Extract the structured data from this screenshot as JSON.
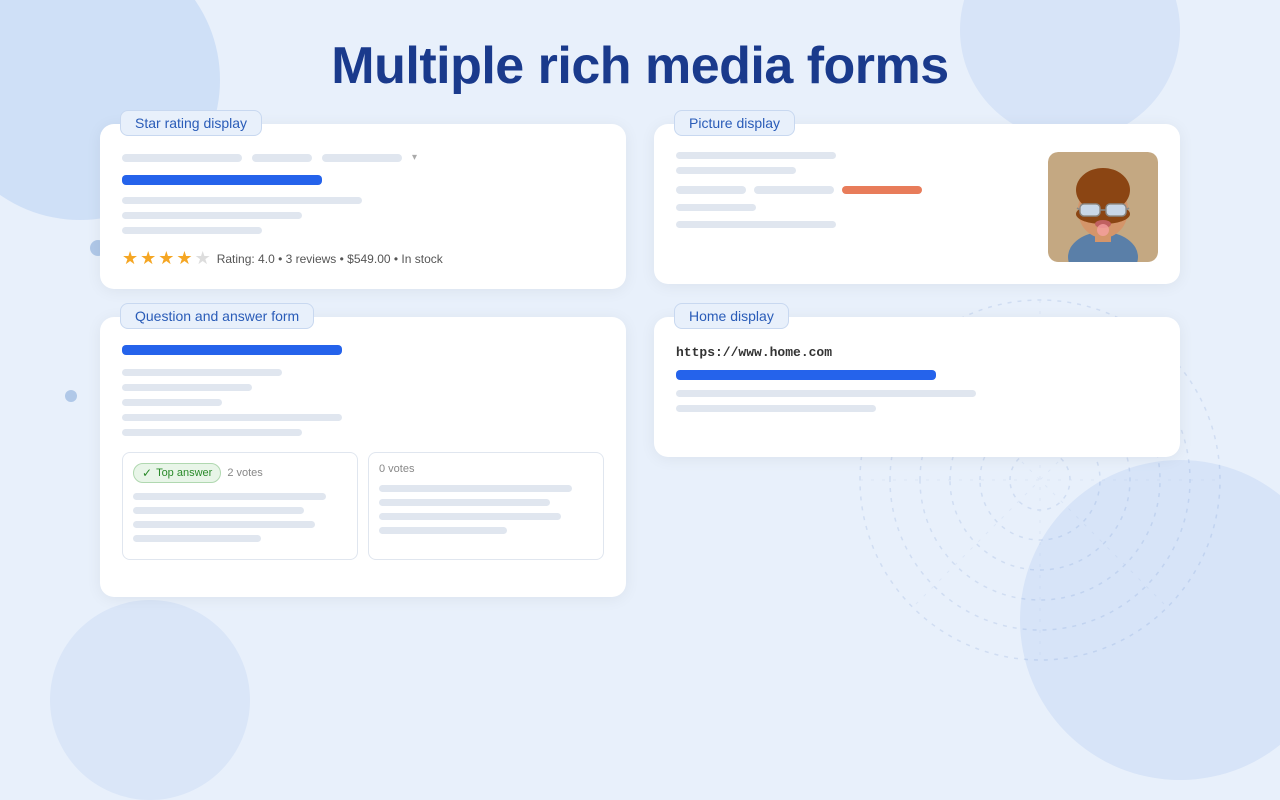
{
  "page": {
    "title": "Multiple rich media forms",
    "background_color": "#e8f0fb"
  },
  "cards": {
    "star_rating": {
      "label": "Star rating display",
      "rating_value": "4.0",
      "reviews_count": "3 reviews",
      "price": "$549.00",
      "stock": "In stock",
      "rating_text": "Rating: 4.0  •  3 reviews  •  $549.00  •  In stock"
    },
    "picture_display": {
      "label": "Picture display"
    },
    "qa_form": {
      "label": "Question and answer form",
      "top_answer_label": "Top answer",
      "votes_top": "2 votes",
      "votes_other": "0 votes"
    },
    "home_display": {
      "label": "Home display",
      "url": "https://www.home.com"
    }
  }
}
